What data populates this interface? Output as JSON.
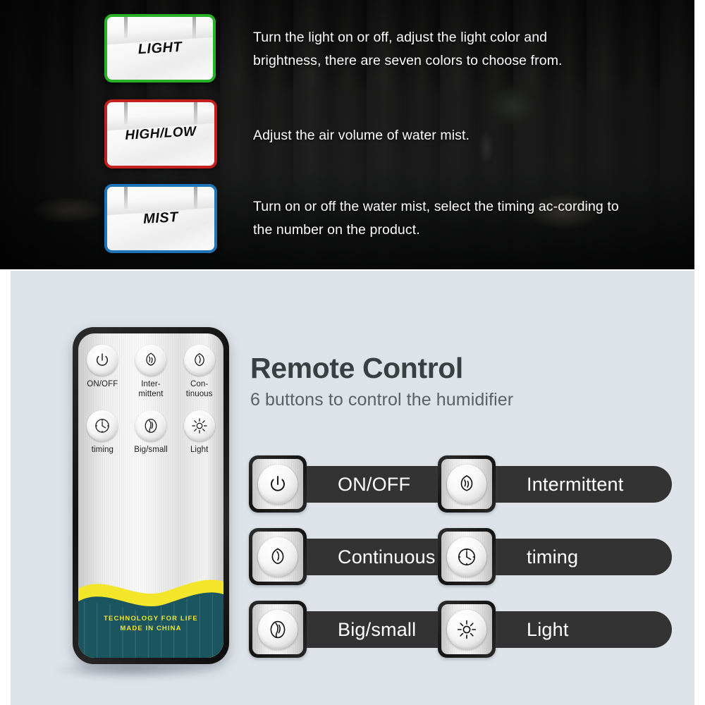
{
  "hero": {
    "features": [
      {
        "chip_label": "LIGHT",
        "border_color": "#27b127",
        "description": "Turn the light on or off, adjust the light color and brightness, there are seven colors to choose from."
      },
      {
        "chip_label": "HIGH/LOW",
        "border_color": "#c4201f",
        "description": "Adjust the air volume of water mist."
      },
      {
        "chip_label": "MIST",
        "border_color": "#1f74b8",
        "description": "Turn on or off the water mist, select the timing ac-cording to the number on the product."
      }
    ]
  },
  "lower": {
    "heading": {
      "title": "Remote Control",
      "subtitle": "6 buttons to control the humidifier"
    },
    "remote": {
      "buttons": [
        {
          "label": "ON/OFF",
          "icon": "power-icon"
        },
        {
          "label": "Inter-\nmittent",
          "label_line1": "Inter-",
          "label_line2": "mittent",
          "icon": "intermittent-mist-icon"
        },
        {
          "label": "Con-\ntinuous",
          "label_line1": "Con-",
          "label_line2": "tinuous",
          "icon": "continuous-mist-icon"
        },
        {
          "label": "timing",
          "icon": "clock-icon"
        },
        {
          "label": "Big/small",
          "icon": "big-small-mist-icon"
        },
        {
          "label": "Light",
          "icon": "sun-icon"
        }
      ],
      "footer_line1": "TECHNOLOGY FOR LIFE",
      "footer_line2": "MADE IN CHINA",
      "body_color": "#1b5560",
      "wave_color": "#f3e52a",
      "footer_text_color": "#f3e52a"
    },
    "legend_rows": [
      {
        "left_label": "ON/OFF",
        "left_icon": "power-icon",
        "right_label": "Intermittent",
        "right_icon": "intermittent-mist-icon"
      },
      {
        "left_label": "Continuous",
        "left_icon": "continuous-mist-icon",
        "right_label": "timing",
        "right_icon": "clock-icon"
      },
      {
        "left_label": "Big/small",
        "left_icon": "big-small-mist-icon",
        "right_label": "Light",
        "right_icon": "sun-icon"
      }
    ],
    "background_color": "#dde3e9",
    "pill_color": "#333333"
  }
}
